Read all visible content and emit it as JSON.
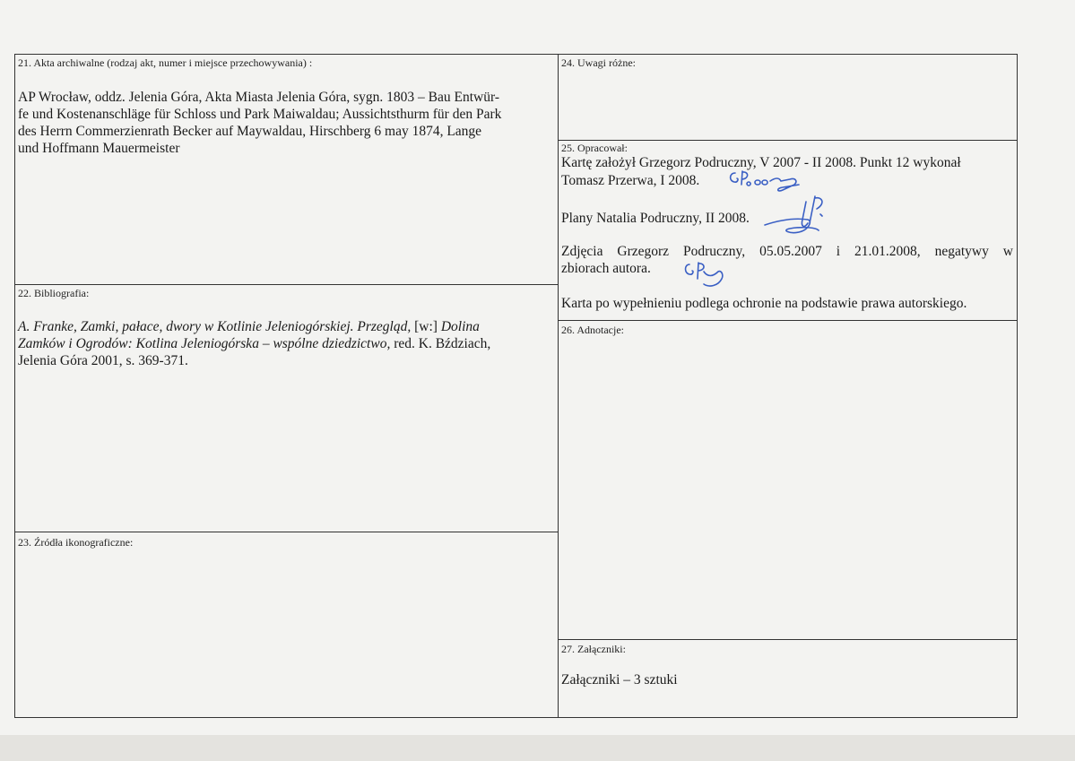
{
  "section21": {
    "label": "21. Akta archiwalne (rodzaj akt, numer i miejsce przechowywania) :",
    "text_line1": "AP Wrocław, oddz. Jelenia Góra, Akta Miasta Jelenia Góra, sygn. 1803 – Bau Entwür-",
    "text_line2": "fe und Kostenanschläge für Schloss und Park Maiwaldau; Aussichtsthurm für den Park",
    "text_line3": "des Herrn Commerzienrath Becker auf Maywaldau, Hirschberg 6 may 1874, Lange",
    "text_line4": "und Hoffmann Mauermeister"
  },
  "section22": {
    "label": "22. Bibliografia:",
    "italic1": "A. Franke, Zamki, pałace, dwory w Kotlinie Jeleniogórskiej. Przegląd,",
    "plain1": " [w:] ",
    "italic2": "Dolina",
    "italic3": "Zamków i Ogrodów: Kotlina Jeleniogórska – wspólne dziedzictwo,",
    "plain2": " red. K. Bździach,",
    "plain3": "Jelenia Góra 2001, s. 369-371."
  },
  "section23": {
    "label": "23. Źródła ikonograficzne:"
  },
  "section24": {
    "label": "24. Uwagi różne:"
  },
  "section25": {
    "label": "25. Opracował:",
    "line1": "Kartę założył Grzegorz Podruczny, V 2007 - II 2008. Punkt 12 wykonał",
    "line2": "Tomasz Przerwa, I 2008.",
    "line3": "Plany Natalia Podruczny, II 2008.",
    "line4": "Zdjęcia Grzegorz Podruczny, 05.05.2007 i 21.01.2008, negatywy w",
    "line5": "zbiorach autora.",
    "line6": "Karta po wypełnieniu podlega ochronie na podstawie prawa autorskiego."
  },
  "section26": {
    "label": "26. Adnotacje:"
  },
  "section27": {
    "label": "27. Załączniki:",
    "text": "Załączniki – 3 sztuki"
  },
  "colors": {
    "ink_signature": "#3a5fc4",
    "border": "#333333"
  }
}
